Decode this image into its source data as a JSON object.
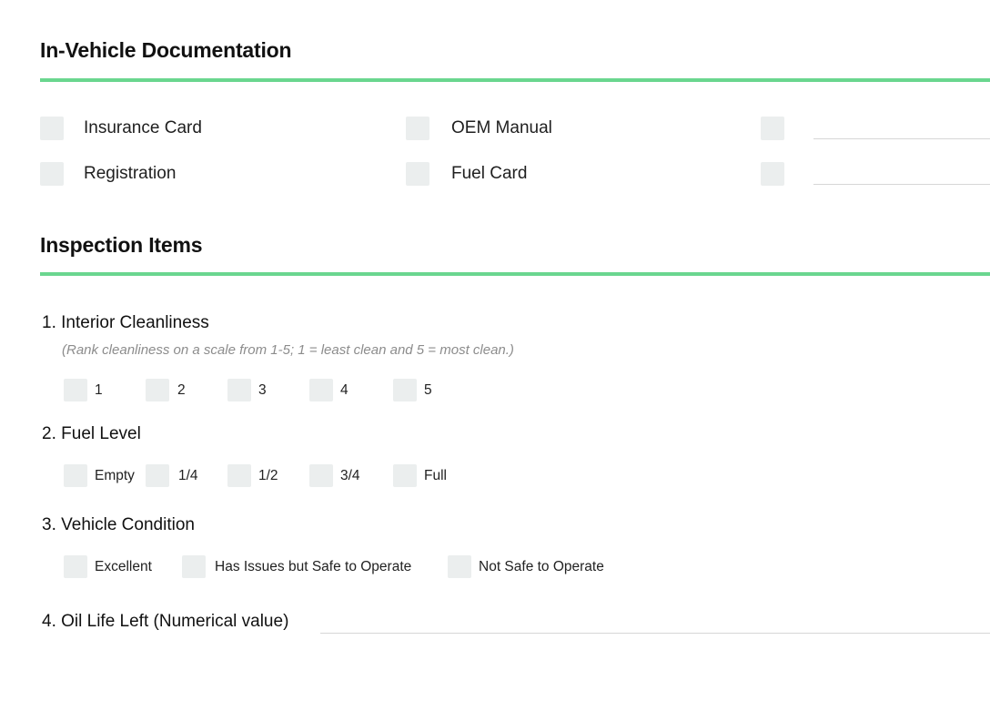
{
  "documentation": {
    "heading": "In-Vehicle Documentation",
    "items": [
      "Insurance Card",
      "Registration",
      "OEM Manual",
      "Fuel Card"
    ]
  },
  "inspection": {
    "heading": "Inspection Items",
    "q1": {
      "number": "1.",
      "title": "Interior Cleanliness",
      "hint": "(Rank cleanliness on a scale from 1-5; 1 = least clean and 5 = most clean.)",
      "options": [
        "1",
        "2",
        "3",
        "4",
        "5"
      ]
    },
    "q2": {
      "number": "2.",
      "title": "Fuel Level",
      "options": [
        "Empty",
        "1/4",
        "1/2",
        "3/4",
        "Full"
      ]
    },
    "q3": {
      "number": "3.",
      "title": "Vehicle Condition",
      "options": [
        "Excellent",
        "Has Issues but Safe to Operate",
        "Not Safe to Operate"
      ]
    },
    "q4": {
      "number": "4.",
      "title": "Oil Life Left (Numerical value)"
    }
  },
  "colors": {
    "accent": "#6ad68f",
    "checkbox": "#ebeeee",
    "line": "#d6d6d6"
  }
}
